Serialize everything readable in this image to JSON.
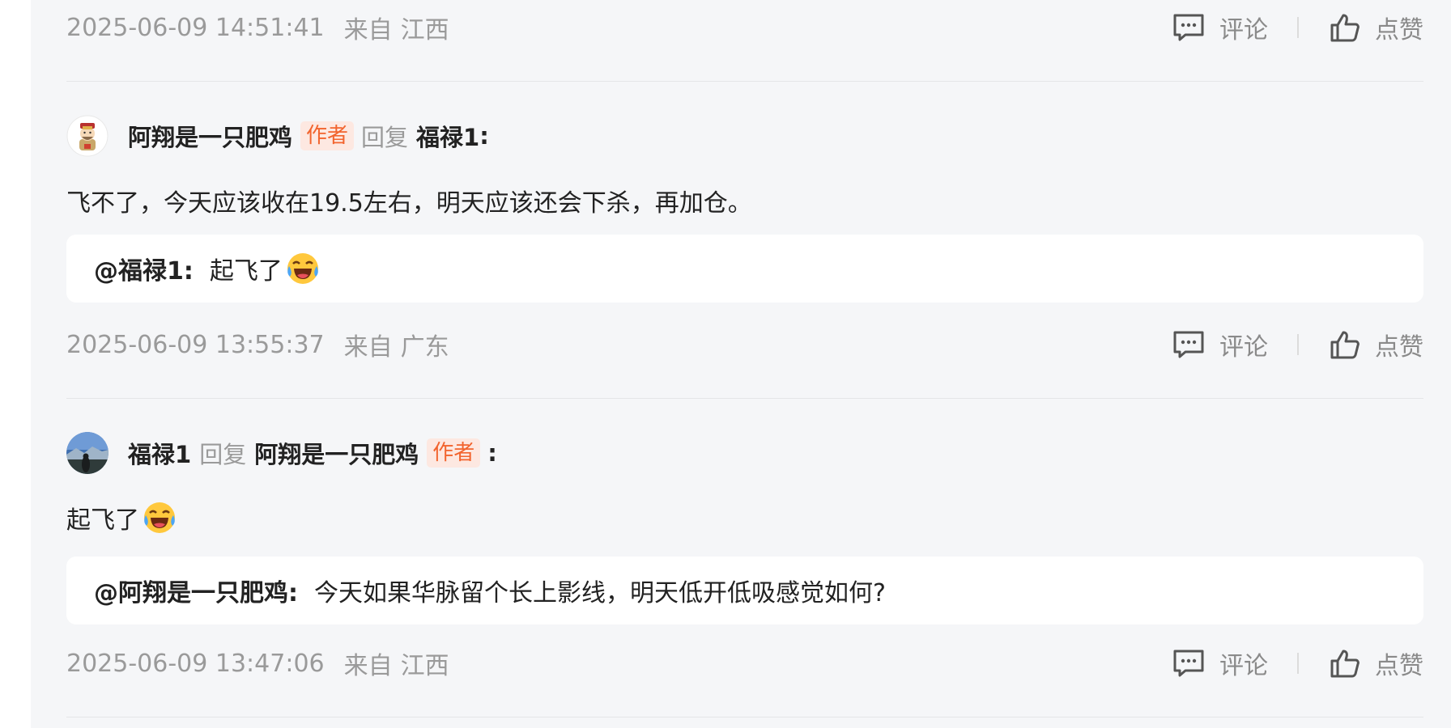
{
  "actions": {
    "comment_label": "评论",
    "like_label": "点赞"
  },
  "loc_prefix": "来自",
  "comments": [
    {
      "timestamp": "2025-06-09 14:51:41",
      "location": "江西"
    },
    {
      "author": "阿翔是一只肥鸡",
      "author_badge": "作者",
      "reply_word": "回复",
      "reply_to": "福禄1",
      "colon": ":",
      "text": "飞不了，今天应该收在19.5左右，明天应该还会下杀，再加仓。",
      "quote_name": "@福禄1:",
      "quote_text": "起飞了",
      "quote_emoji": "laughing-crying-emoji",
      "timestamp": "2025-06-09 13:55:37",
      "location": "广东"
    },
    {
      "author": "福禄1",
      "reply_word": "回复",
      "reply_to": "阿翔是一只肥鸡",
      "reply_to_badge": "作者",
      "colon": ":",
      "text": "起飞了",
      "text_emoji": "laughing-crying-emoji",
      "quote_name": "@阿翔是一只肥鸡:",
      "quote_text": "今天如果华脉留个长上影线，明天低开低吸感觉如何?",
      "timestamp": "2025-06-09 13:47:06",
      "location": "江西"
    }
  ],
  "colors": {
    "panel_bg": "#f5f6f8",
    "badge_bg": "#fde8e1",
    "badge_text": "#f2642e",
    "muted_text": "#9a9a9a"
  }
}
